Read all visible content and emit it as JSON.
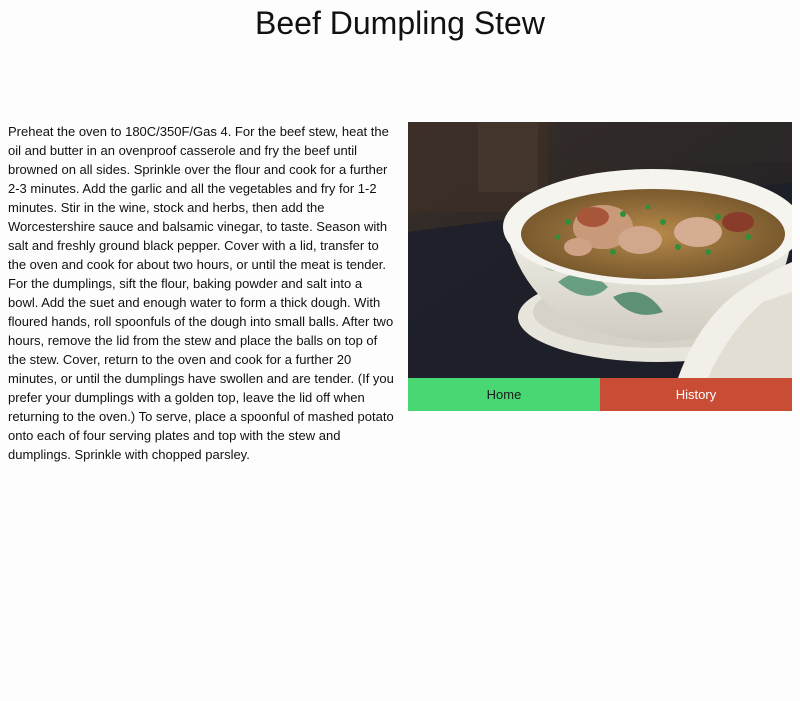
{
  "page": {
    "title": "Beef Dumpling Stew"
  },
  "recipe": {
    "instructions": "Preheat the oven to 180C/350F/Gas 4. For the beef stew, heat the oil and butter in an ovenproof casserole and fry the beef until browned on all sides. Sprinkle over the flour and cook for a further 2-3 minutes. Add the garlic and all the vegetables and fry for 1-2 minutes. Stir in the wine, stock and herbs, then add the Worcestershire sauce and balsamic vinegar, to taste. Season with salt and freshly ground black pepper. Cover with a lid, transfer to the oven and cook for about two hours, or until the meat is tender. For the dumplings, sift the flour, baking powder and salt into a bowl. Add the suet and enough water to form a thick dough. With floured hands, roll spoonfuls of the dough into small balls. After two hours, remove the lid from the stew and place the balls on top of the stew. Cover, return to the oven and cook for a further 20 minutes, or until the dumplings have swollen and are tender. (If you prefer your dumplings with a golden top, leave the lid off when returning to the oven.) To serve, place a spoonful of mashed potato onto each of four serving plates and top with the stew and dumplings. Sprinkle with chopped parsley."
  },
  "nav": {
    "home_label": "Home",
    "history_label": "History",
    "home_color": "#49d774",
    "history_color": "#c94d35"
  }
}
